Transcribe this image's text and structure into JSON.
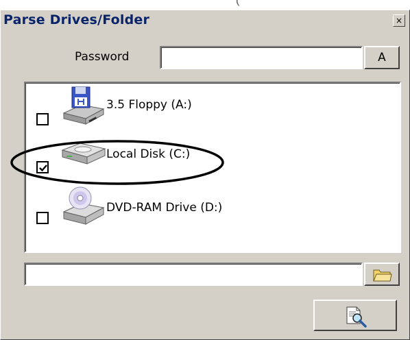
{
  "top_fragment": "(",
  "window": {
    "title": "Parse Drives/Folder",
    "close_glyph": "×"
  },
  "password": {
    "label": "Password",
    "value": "",
    "action_label": "A"
  },
  "drives": [
    {
      "label": "3.5 Floppy (A:)",
      "checked": false,
      "icon": "floppy-drive-icon"
    },
    {
      "label": "Local Disk (C:)",
      "checked": true,
      "icon": "hard-disk-icon",
      "highlighted": true
    },
    {
      "label": "DVD-RAM Drive (D:)",
      "checked": false,
      "icon": "dvd-drive-icon"
    }
  ],
  "folder_path": {
    "value": "",
    "browse_icon": "folder-icon"
  },
  "search_button": {
    "icon": "magnifier-document-icon"
  },
  "colors": {
    "dialog_bg": "#d4d0c8",
    "title_text": "#0a246a",
    "highlight_ring": "#000000"
  }
}
